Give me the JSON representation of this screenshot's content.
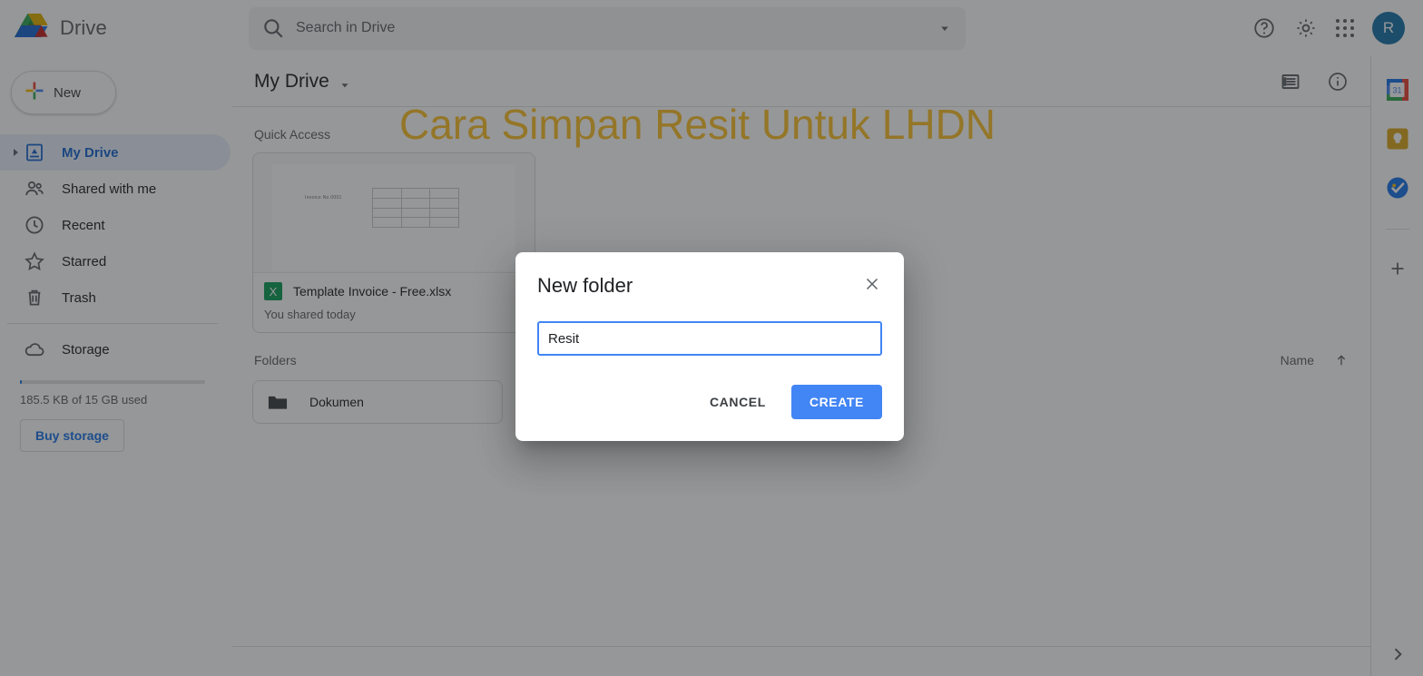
{
  "app": {
    "brand_name": "Drive",
    "logo_icon": "google-drive-logo"
  },
  "search": {
    "placeholder": "Search in Drive",
    "value": "",
    "icon": "search-icon",
    "options_icon": "chevron-down-icon"
  },
  "header": {
    "help_icon": "help-circle-icon",
    "settings_icon": "gear-icon",
    "apps_icon": "apps-grid-icon",
    "avatar_initial": "R"
  },
  "sidebar": {
    "new_button": "New",
    "new_icon": "plus-icon",
    "items": [
      {
        "label": "My Drive",
        "icon": "my-drive-icon",
        "active": true,
        "expandable": true
      },
      {
        "label": "Shared with me",
        "icon": "people-icon",
        "active": false,
        "expandable": false
      },
      {
        "label": "Recent",
        "icon": "clock-icon",
        "active": false,
        "expandable": false
      },
      {
        "label": "Starred",
        "icon": "star-icon",
        "active": false,
        "expandable": false
      },
      {
        "label": "Trash",
        "icon": "trash-icon",
        "active": false,
        "expandable": false
      }
    ],
    "storage_label": "Storage",
    "storage_icon": "cloud-icon",
    "storage_text": "185.5 KB of 15 GB used",
    "buy_storage": "Buy storage"
  },
  "main": {
    "breadcrumb": "My Drive",
    "breadcrumb_caret": "chevron-down-icon",
    "list_view_icon": "list-view-icon",
    "details_icon": "info-circle-icon",
    "quick_access_label": "Quick Access",
    "files": [
      {
        "name": "Template Invoice - Free.xlsx",
        "subtitle": "You shared today",
        "type_icon": "excel-icon",
        "type_letter": "X",
        "thumb_text": "Invoice No    0001"
      }
    ],
    "folders_label": "Folders",
    "sort_column": "Name",
    "sort_direction_icon": "arrow-up-icon",
    "folders": [
      {
        "name": "Dokumen",
        "icon": "folder-icon"
      }
    ]
  },
  "rail": {
    "apps": [
      {
        "name": "google-calendar-icon",
        "label": "31"
      },
      {
        "name": "google-keep-icon",
        "label": ""
      },
      {
        "name": "google-tasks-icon",
        "label": ""
      }
    ],
    "add_icon": "plus-icon",
    "expand_icon": "chevron-right-icon"
  },
  "overlay": {
    "caption": "Cara Simpan Resit Untuk LHDN",
    "caption_color": "#fbc02d"
  },
  "dialog": {
    "title": "New folder",
    "close_icon": "close-icon",
    "input_value": "Resit",
    "input_placeholder": "",
    "cancel_label": "CANCEL",
    "create_label": "CREATE",
    "create_color": "#4285f4"
  }
}
